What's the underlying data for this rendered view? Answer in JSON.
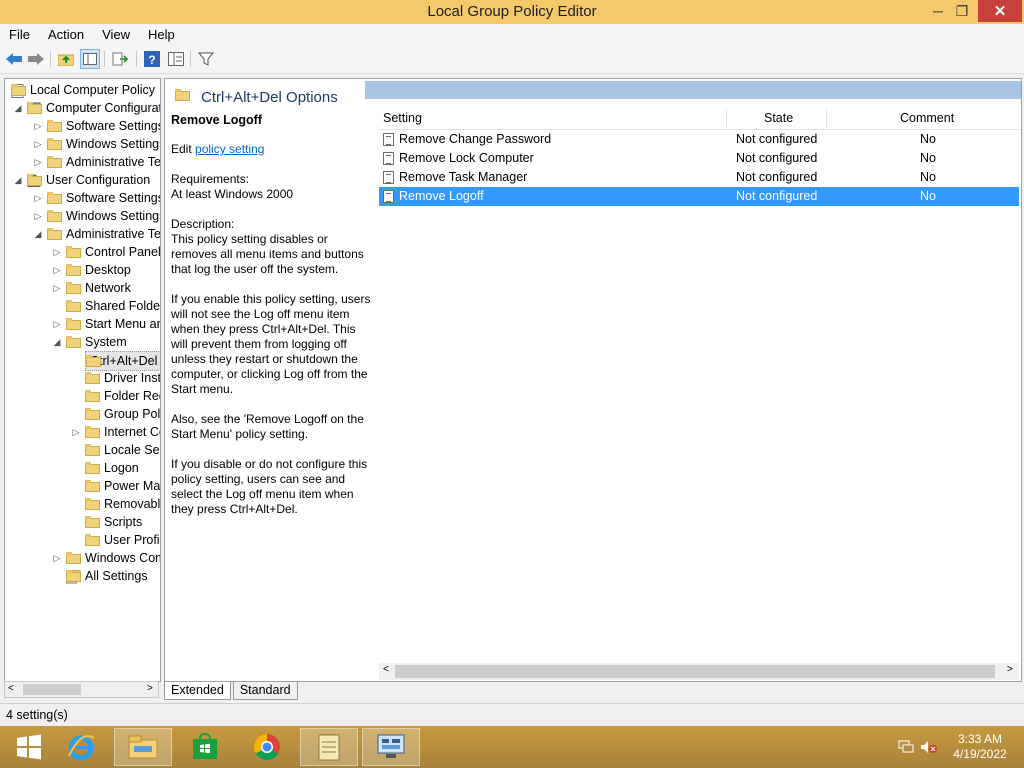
{
  "window": {
    "title": "Local Group Policy Editor",
    "min": "─",
    "max": "❐",
    "close": "✕"
  },
  "menu": [
    "File",
    "Action",
    "View",
    "Help"
  ],
  "tree": {
    "items": [
      {
        "label": "Local Computer Policy"
      },
      {
        "label": "Computer Configuration"
      },
      {
        "label": "Software Settings"
      },
      {
        "label": "Windows Settings"
      },
      {
        "label": "Administrative Templates"
      },
      {
        "label": "User Configuration"
      },
      {
        "label": "Software Settings"
      },
      {
        "label": "Windows Settings"
      },
      {
        "label": "Administrative Templates"
      },
      {
        "label": "Control Panel"
      },
      {
        "label": "Desktop"
      },
      {
        "label": "Network"
      },
      {
        "label": "Shared Folders"
      },
      {
        "label": "Start Menu and Taskbar"
      },
      {
        "label": "System"
      },
      {
        "label": "Ctrl+Alt+Del Options"
      },
      {
        "label": "Driver Installation"
      },
      {
        "label": "Folder Redirection"
      },
      {
        "label": "Group Policy"
      },
      {
        "label": "Internet Communication Management"
      },
      {
        "label": "Locale Services"
      },
      {
        "label": "Logon"
      },
      {
        "label": "Power Management"
      },
      {
        "label": "Removable Storage Access"
      },
      {
        "label": "Scripts"
      },
      {
        "label": "User Profiles"
      },
      {
        "label": "Windows Components"
      },
      {
        "label": "All Settings"
      }
    ]
  },
  "pane": {
    "header": "Ctrl+Alt+Del Options",
    "desc": {
      "title": "Remove Logoff",
      "edit_prefix": "Edit ",
      "edit_link": "policy setting",
      "req_label": "Requirements:",
      "req_value": "At least Windows 2000",
      "desc_label": "Description:",
      "p1": "This policy setting disables or removes all menu items and buttons that log the user off the system.",
      "p2": "If you enable this policy setting, users will not see the Log off menu item when they press Ctrl+Alt+Del. This will prevent them from logging off unless they restart or shutdown the computer, or clicking Log off from the Start menu.",
      "p3": "Also, see the 'Remove Logoff on the Start Menu' policy setting.",
      "p4": "If you disable or do not configure this policy setting, users can see and select the Log off menu item when they press Ctrl+Alt+Del."
    },
    "columns": {
      "setting": "Setting",
      "state": "State",
      "comment": "Comment"
    },
    "rows": [
      {
        "setting": "Remove Change Password",
        "state": "Not configured",
        "comment": "No"
      },
      {
        "setting": "Remove Lock Computer",
        "state": "Not configured",
        "comment": "No"
      },
      {
        "setting": "Remove Task Manager",
        "state": "Not configured",
        "comment": "No"
      },
      {
        "setting": "Remove Logoff",
        "state": "Not configured",
        "comment": "No"
      }
    ]
  },
  "tabs": [
    "Extended",
    "Standard"
  ],
  "status": "4 setting(s)",
  "clock": {
    "time": "3:33 AM",
    "date": "4/19/2022"
  }
}
